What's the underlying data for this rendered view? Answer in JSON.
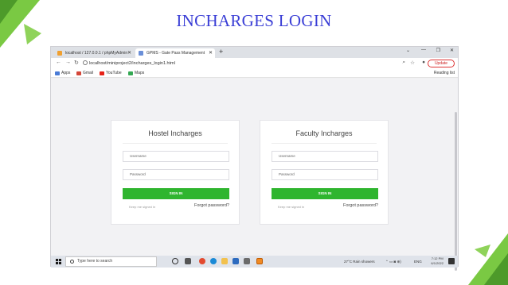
{
  "slide": {
    "title": "INCHARGES LOGIN",
    "accent_color": "#7ac943"
  },
  "browser": {
    "tabs": [
      {
        "label": "localhost / 127.0.0.1 / phpMyAdmin",
        "icon": "phpmyadmin-icon"
      },
      {
        "label": "GPMS - Gate Pass Management",
        "icon": "page-icon"
      }
    ],
    "url": "localhost/miniproject2/incharges_login1.html",
    "update_label": "Update",
    "bookmarks": [
      {
        "label": "Apps",
        "color": "#4a7bd6"
      },
      {
        "label": "Gmail",
        "color": "#d44638"
      },
      {
        "label": "YouTube",
        "color": "#e62117"
      },
      {
        "label": "Maps",
        "color": "#34a853"
      }
    ],
    "reading_list": "Reading list"
  },
  "cards": [
    {
      "title": "Hostel Incharges",
      "username_placeholder": "Username",
      "password_placeholder": "Password",
      "signin_label": "SIGN IN",
      "keep_signed_in": "Keep me signed in",
      "forgot_password": "Forgot password?"
    },
    {
      "title": "Faculty Incharges",
      "username_placeholder": "Username",
      "password_placeholder": "Password",
      "signin_label": "SIGN IN",
      "keep_signed_in": "Keep me signed in",
      "forgot_password": "Forgot password?"
    }
  ],
  "taskbar": {
    "search_placeholder": "Type here to search",
    "weather": "27°C  Rain showers",
    "language": "ENG",
    "time": "7:12 PM",
    "date": "6/1/2022"
  },
  "colors": {
    "signin_button": "#2fb52f",
    "title_color": "#3b3fd6"
  }
}
